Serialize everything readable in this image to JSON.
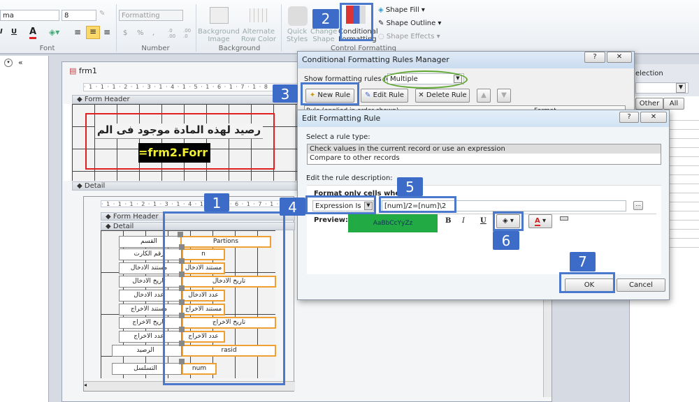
{
  "ribbon": {
    "font_name": "ma",
    "font_size": "8",
    "format_box": "Formatting",
    "font_buttons": [
      "I",
      "U",
      "A"
    ],
    "number_buttons": [
      "$",
      "%",
      ",",
      ".0 .00",
      ".00 .0"
    ],
    "group_font": "Font",
    "group_number": "Number",
    "group_background": "Background",
    "group_control": "Control Formatting",
    "background_image": "Background Image",
    "alternate_row_color": "Alternate Row Color",
    "quick_styles": "Quick Styles",
    "change_shape": "Change Shape",
    "conditional_formatting": "Conditional Formatting",
    "shape_fill": "Shape Fill",
    "shape_outline": "Shape Outline",
    "shape_effects": "Shape Effects"
  },
  "nav": {
    "collapse": "«"
  },
  "form": {
    "tab": "frm1",
    "ruler": "· 1 · 1 · 1 · 2 · 1 · 3 · 1 · 4 · 1 · 5 · 1 · 6 · 1 · 7 · 1 · 8",
    "form_header": "Form Header",
    "detail": "Detail",
    "header_label": "رصيد لهذه المادة موجود فى الم",
    "header_textbox": "=frm2.Forr",
    "sub": {
      "form_header": "Form Header",
      "detail": "Detail",
      "labels": [
        "القسم",
        "رقم الكارت",
        "مستند الادخال",
        "تاريخ الادخال",
        "عدد الادخال",
        "مستند الاخراج",
        "تاريخ الاخراج",
        "عدد الاخراج",
        "الرصيد",
        "التسلسل"
      ],
      "fields": [
        "Partions",
        "n",
        "مستند الادخال",
        "تاريخ الادخال",
        "عدد الادخال",
        "مستند الاخراج",
        "تاريخ الاخراج",
        "عدد الاخراج",
        "rasid",
        "num"
      ]
    }
  },
  "property_sheet": {
    "title": "election",
    "tabs": [
      "Other",
      "All"
    ]
  },
  "rules_manager": {
    "title": "Conditional Formatting Rules Manager",
    "show_for_label": "Show formatting rules for:",
    "show_for_value": "Multiple",
    "new_rule": "New Rule",
    "edit_rule": "Edit Rule",
    "delete_rule": "Delete Rule",
    "col_rule": "Rule (applied in order shown)",
    "col_format": "Format"
  },
  "edit_rule": {
    "title": "Edit Formatting Rule",
    "select_type_label": "Select a rule type:",
    "rule_types": [
      "Check values in the current record or use an expression",
      "Compare to other records"
    ],
    "edit_desc_label": "Edit the rule description:",
    "format_only": "Format only cells where t",
    "condition": "Expression Is",
    "expression": "[num]/2=[num]\\2",
    "preview_label": "Preview:",
    "preview_text": "AaBbCcYyZz",
    "preview_color": "#22aa44",
    "bold": "B",
    "italic": "I",
    "underline": "U",
    "ellipsis": "...",
    "ok": "OK",
    "cancel": "Cancel"
  },
  "badges": [
    "1",
    "2",
    "3",
    "4",
    "5",
    "6",
    "7"
  ],
  "colors": {
    "badge": "#3d6cc8",
    "highlight_ellipse": "#5ea832",
    "header_box": "#e02020"
  }
}
